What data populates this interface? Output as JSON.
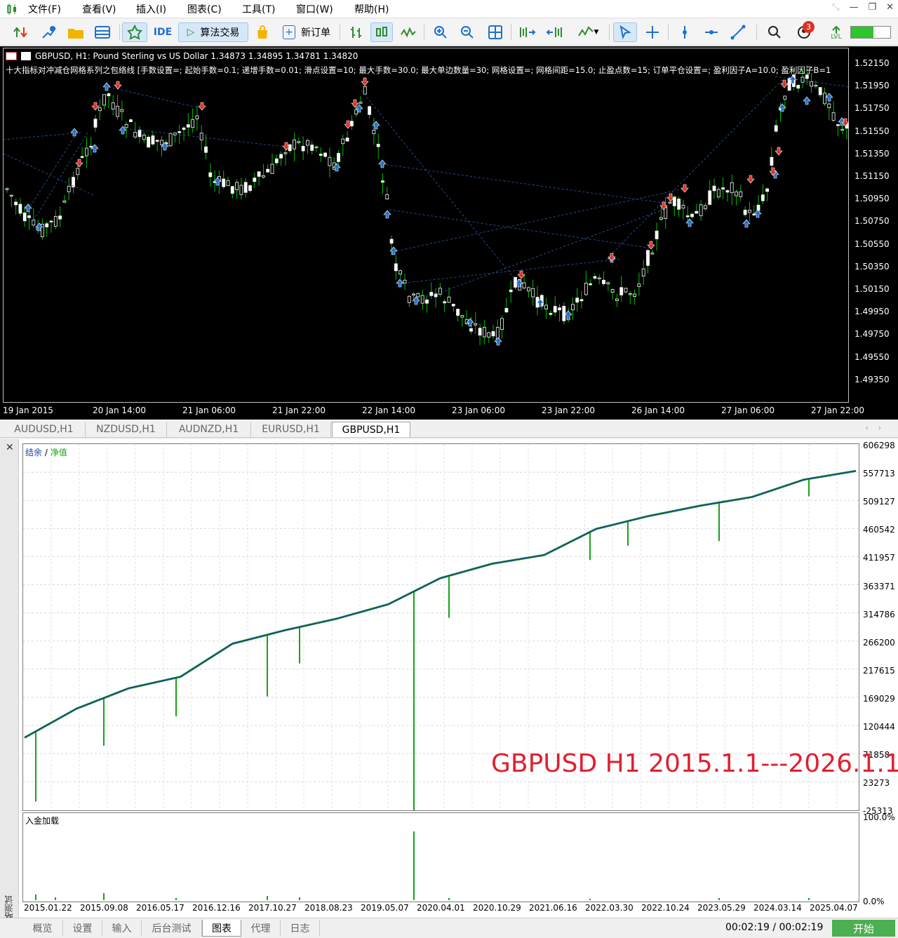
{
  "menu": {
    "items": [
      "文件(F)",
      "查看(V)",
      "插入(I)",
      "图表(C)",
      "工具(T)",
      "窗口(W)",
      "帮助(H)"
    ]
  },
  "toolbar": {
    "ide_label": "IDE",
    "algo_label": "算法交易",
    "new_order_label": "新订单",
    "notifications": "3",
    "lvl_label": "LVL",
    "accent": "#2e8b2e"
  },
  "chart": {
    "header": "GBPUSD, H1:  Pound Sterling vs US Dollar  1.34873 1.34895 1.34781 1.34820",
    "ea_params": "十大指标对冲减仓网格系列之包络线 [手数设置=; 起始手数=0.1; 递增手数=0.01; 滑点设置=10; 最大手数=30.0; 最大单边数量=30; 网格设置=; 网格间距=15.0; 止盈点数=15; 订单平仓设置=; 盈利因子A=10.0; 盈利因子B=1",
    "price_labels": [
      "1.52150",
      "1.51950",
      "1.51750",
      "1.51550",
      "1.51350",
      "1.51150",
      "1.50950",
      "1.50750",
      "1.50550",
      "1.50350",
      "1.50150",
      "1.49950",
      "1.49750",
      "1.49550",
      "1.49350"
    ],
    "time_labels": [
      "19 Jan 2015",
      "20 Jan 14:00",
      "21 Jan 06:00",
      "21 Jan 22:00",
      "22 Jan 14:00",
      "23 Jan 06:00",
      "23 Jan 22:00",
      "26 Jan 14:00",
      "27 Jan 06:00",
      "27 Jan 22:00"
    ],
    "candle_color_up": "#ffffff",
    "candle_color_wick": "#00c000",
    "buy_marker": "#1e6fd0",
    "sell_marker": "#e03020"
  },
  "symbol_tabs": [
    "AUDUSD,H1",
    "NZDUSD,H1",
    "AUDNZD,H1",
    "EURUSD,H1",
    "GBPUSD,H1"
  ],
  "active_symbol_tab": "GBPUSD,H1",
  "tester": {
    "legend_balance": "结余",
    "legend_sep": " / ",
    "legend_equity": "净值",
    "balance_labels": [
      "606298",
      "557713",
      "509127",
      "460542",
      "411957",
      "363371",
      "314786",
      "266200",
      "217615",
      "169029",
      "120444",
      "71858",
      "23273",
      "-25313"
    ],
    "overlay_text": "GBPUSD H1 2015.1.1---2026.1.1",
    "deposit_title": "入金加载",
    "deposit_top": "100.0%",
    "deposit_bottom": "0.0%",
    "date_labels": [
      "2015.01.22",
      "2015.09.08",
      "2016.05.17",
      "2016.12.16",
      "2017.10.27",
      "2018.08.23",
      "2019.05.07",
      "2020.04.01",
      "2020.10.29",
      "2021.06.16",
      "2022.03.30",
      "2022.10.24",
      "2023.05.29",
      "2024.03.14",
      "2025.04.07"
    ],
    "side_label": "策略测试",
    "balance_color": "#1f3fa0",
    "equity_color": "#17a317",
    "chart_data": {
      "type": "line",
      "title": "",
      "series": [
        {
          "name": "结余",
          "x": [
            "2015.01.22",
            "2015.09.08",
            "2016.05.17",
            "2016.12.16",
            "2017.10.27",
            "2018.08.23",
            "2019.05.07",
            "2019.12.01",
            "2020.04.01",
            "2020.10.29",
            "2021.06.16",
            "2022.03.30",
            "2022.10.24",
            "2023.05.29",
            "2024.03.14",
            "2025.04.07",
            "2025.12.31"
          ],
          "values": [
            100000,
            150000,
            185000,
            205000,
            262000,
            285000,
            305000,
            330000,
            375000,
            400000,
            415000,
            460000,
            482000,
            500000,
            515000,
            545000,
            560000
          ]
        }
      ],
      "ylim": [
        -25313,
        606298
      ],
      "grid": true
    }
  },
  "bottom_tabs": [
    "概览",
    "设置",
    "输入",
    "后台测试",
    "图表",
    "代理",
    "日志"
  ],
  "active_bottom_tab": "图表",
  "timer": "00:02:19 / 00:02:19",
  "start_label": "开始"
}
